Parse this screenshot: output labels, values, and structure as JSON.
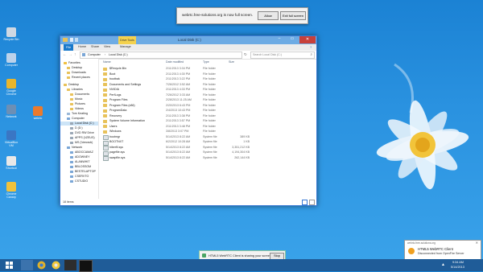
{
  "fullscreen_notice": {
    "text": "webrtc.free-solutions.org is now full screen.",
    "allow": "Allow",
    "exit": "Exit full screen"
  },
  "desktop_icons": [
    {
      "label": "Recycle Bin",
      "color": "#cfd8e3"
    },
    {
      "label": "Computer",
      "color": "#bcd2ea"
    },
    {
      "label": "Google Chrome",
      "color": "#e8b52b"
    },
    {
      "label": "Network",
      "color": "#6c8fb5"
    },
    {
      "label": "VirtualBox VM",
      "color": "#3a76c4"
    },
    {
      "label": "Shortcut",
      "color": "#e8e8e8"
    },
    {
      "label": "Chrome Canary",
      "color": "#f0c23c"
    },
    {
      "label": "webrtc",
      "color": "#ec7a2c"
    }
  ],
  "explorer": {
    "context_tab": "Drive Tools",
    "title": "Local Disk (C:)",
    "tabs": [
      "File",
      "Home",
      "Share",
      "View",
      "Manage"
    ],
    "breadcrumb": [
      "Computer",
      "Local Disk (C:)"
    ],
    "search_placeholder": "Search Local Disk (C:)",
    "nav_items": [
      {
        "label": "Favorites",
        "indent": 0,
        "kind": "star"
      },
      {
        "label": "Desktop",
        "indent": 1,
        "kind": "folder"
      },
      {
        "label": "Downloads",
        "indent": 1,
        "kind": "folder"
      },
      {
        "label": "Recent places",
        "indent": 1,
        "kind": "folder"
      },
      {
        "label": "",
        "indent": 0,
        "kind": "spacer"
      },
      {
        "label": "Desktop",
        "indent": 0,
        "kind": "folder"
      },
      {
        "label": "Libraries",
        "indent": 1,
        "kind": "folder"
      },
      {
        "label": "Documents",
        "indent": 2,
        "kind": "folder"
      },
      {
        "label": "Music",
        "indent": 2,
        "kind": "folder"
      },
      {
        "label": "Pictures",
        "indent": 2,
        "kind": "folder"
      },
      {
        "label": "Videos",
        "indent": 2,
        "kind": "folder"
      },
      {
        "label": "Tom Keating",
        "indent": 1,
        "kind": "user"
      },
      {
        "label": "Computer",
        "indent": 1,
        "kind": "pc"
      },
      {
        "label": "Local Disk (C:)",
        "indent": 2,
        "kind": "drive",
        "selected": true
      },
      {
        "label": "D (D:)",
        "indent": 2,
        "kind": "drive"
      },
      {
        "label": "DVD RW Drive",
        "indent": 2,
        "kind": "drive"
      },
      {
        "label": "APPS (\\\\ZEUS)",
        "indent": 2,
        "kind": "drive"
      },
      {
        "label": "MS (\\\\trecsvb)",
        "indent": 2,
        "kind": "drive"
      },
      {
        "label": "Network",
        "indent": 1,
        "kind": "pc"
      },
      {
        "label": "ABOCCAMAZ",
        "indent": 2,
        "kind": "pc"
      },
      {
        "label": "ADOWNEY",
        "indent": 2,
        "kind": "pc"
      },
      {
        "label": "ALANWHIT",
        "indent": 2,
        "kind": "pc"
      },
      {
        "label": "BBLOSSOM",
        "indent": 2,
        "kind": "pc"
      },
      {
        "label": "BESTELAPTOP",
        "indent": 2,
        "kind": "pc"
      },
      {
        "label": "CSERVTO",
        "indent": 2,
        "kind": "pc"
      },
      {
        "label": "CSTUDIO",
        "indent": 2,
        "kind": "pc"
      }
    ],
    "columns": [
      "Name",
      "Date modified",
      "Type",
      "Size"
    ],
    "files": [
      {
        "name": "$Recycle.Bin",
        "date": "2/11/2013 3:34 PM",
        "type": "File folder",
        "size": "",
        "kind": "folder"
      },
      {
        "name": "Boot",
        "date": "2/11/2013 4:30 PM",
        "type": "File folder",
        "size": "",
        "kind": "folder"
      },
      {
        "name": "bootbak",
        "date": "2/11/2013 3:22 PM",
        "type": "File folder",
        "size": "",
        "kind": "folder"
      },
      {
        "name": "Documents and Settings",
        "date": "7/26/2012 3:52 AM",
        "type": "File folder",
        "size": "",
        "kind": "folder"
      },
      {
        "name": "NVIDIA",
        "date": "2/11/2013 4:33 PM",
        "type": "File folder",
        "size": "",
        "kind": "folder"
      },
      {
        "name": "PerfLogs",
        "date": "7/26/2012 3:33 AM",
        "type": "File folder",
        "size": "",
        "kind": "folder"
      },
      {
        "name": "Program Files",
        "date": "2/28/2013 11:25 AM",
        "type": "File folder",
        "size": "",
        "kind": "folder"
      },
      {
        "name": "Program Files (x86)",
        "date": "2/20/2013 6:43 PM",
        "type": "File folder",
        "size": "",
        "kind": "folder"
      },
      {
        "name": "ProgramData",
        "date": "2/4/2013 10:43 PM",
        "type": "File folder",
        "size": "",
        "kind": "folder"
      },
      {
        "name": "Recovery",
        "date": "2/11/2013 3:38 PM",
        "type": "File folder",
        "size": "",
        "kind": "folder"
      },
      {
        "name": "System Volume Information",
        "date": "2/11/2013 3:57 PM",
        "type": "File folder",
        "size": "",
        "kind": "folder"
      },
      {
        "name": "Users",
        "date": "2/11/2013 3:48 PM",
        "type": "File folder",
        "size": "",
        "kind": "folder"
      },
      {
        "name": "Windows",
        "date": "3/8/2013 3:07 PM",
        "type": "File folder",
        "size": "",
        "kind": "folder"
      },
      {
        "name": "bootmgr",
        "date": "5/14/2013 8:22 AM",
        "type": "System file",
        "size": "389 KB",
        "kind": "file"
      },
      {
        "name": "BOOTNXT",
        "date": "6/2/2012 10:28 AM",
        "type": "System file",
        "size": "1 KB",
        "kind": "file"
      },
      {
        "name": "hiberfil.sys",
        "date": "5/14/2013 8:22 AM",
        "type": "System file",
        "size": "3,351,212 KB",
        "kind": "file"
      },
      {
        "name": "pagefile.sys",
        "date": "5/14/2013 8:22 AM",
        "type": "System file",
        "size": "4,194,304 KB",
        "kind": "file"
      },
      {
        "name": "swapfile.sys",
        "date": "5/14/2013 8:22 AM",
        "type": "System file",
        "size": "262,144 KB",
        "kind": "file"
      }
    ],
    "status": "18 items"
  },
  "share_bar": {
    "text": "HTML5 WebRTC Client is sharing your screen.",
    "stop": "Stop"
  },
  "toast": {
    "source": "webrtc.free-solutions.org",
    "title": "HTML5 WebRTC Client",
    "message": "Disconnected from OpenFire Server"
  },
  "taskbar": {
    "time": "9:34 AM",
    "date": "5/14/2013"
  },
  "colors": {
    "desktop": "#2a92e0",
    "taskbar": "#1f5c98",
    "accent": "#3a7bd5",
    "folder": "#e8c25a"
  }
}
